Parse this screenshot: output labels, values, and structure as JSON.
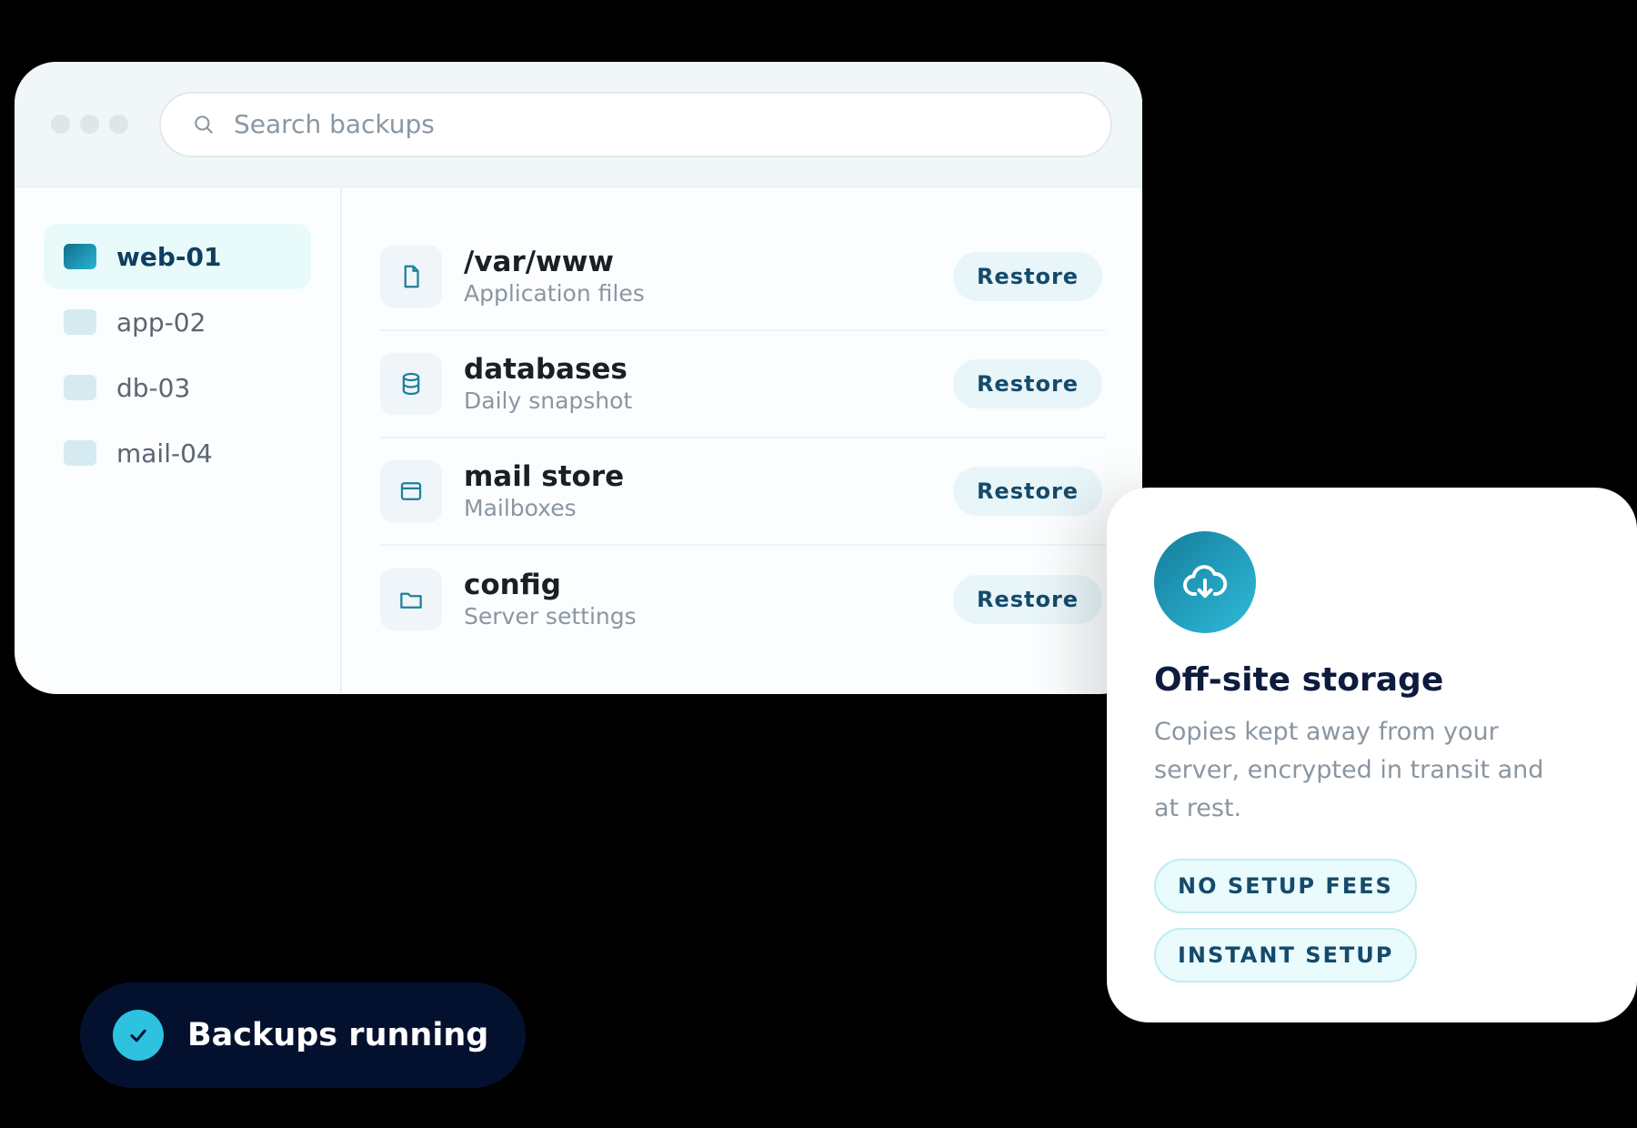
{
  "window": {
    "search": {
      "placeholder": "Search backups"
    },
    "sidebar": {
      "items": [
        {
          "label": "web-01",
          "active": true
        },
        {
          "label": "app-02",
          "active": false
        },
        {
          "label": "db-03",
          "active": false
        },
        {
          "label": "mail-04",
          "active": false
        }
      ]
    },
    "files": [
      {
        "name": "/var/www",
        "subtitle": "Application files",
        "icon": "file-icon",
        "action": "Restore"
      },
      {
        "name": "databases",
        "subtitle": "Daily snapshot",
        "icon": "database-icon",
        "action": "Restore"
      },
      {
        "name": "mail store",
        "subtitle": "Mailboxes",
        "icon": "mailbox-icon",
        "action": "Restore"
      },
      {
        "name": "config",
        "subtitle": "Server settings",
        "icon": "folder-icon",
        "action": "Restore"
      }
    ]
  },
  "card": {
    "icon": "cloud-download-icon",
    "title": "Off-site storage",
    "description": "Copies kept away from your server, encrypted in transit and at rest.",
    "pills": [
      "NO SETUP FEES",
      "INSTANT SETUP"
    ]
  },
  "status": {
    "icon": "check-icon",
    "label": "Backups running"
  },
  "colors": {
    "accent": "#2cc2e0",
    "brand_dark": "#04112e",
    "button_text": "#154a6b"
  }
}
